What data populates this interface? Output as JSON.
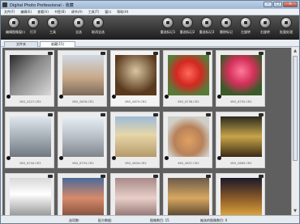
{
  "app": {
    "title": "Digital Photo Professional - 收藏"
  },
  "window_buttons": [
    "–",
    "□",
    "×"
  ],
  "menu": [
    "文件(F)",
    "编辑(E)",
    "查看(V)",
    "书签(B)",
    "调节(A)",
    "工具(T)",
    "窗口",
    "帮助(H)"
  ],
  "toolbar": [
    {
      "label": "编辑图像窗口",
      "icon": "edit-window-icon"
    },
    {
      "label": "打开",
      "icon": "open-icon"
    },
    {
      "label": "工具",
      "icon": "tools-icon"
    },
    {
      "label": "全选",
      "icon": "select-all-icon"
    },
    {
      "label": "取消全选",
      "icon": "deselect-icon"
    },
    {
      "label": "重选标记1",
      "icon": "check-mark1-icon"
    },
    {
      "label": "重选标记2",
      "icon": "check-mark2-icon"
    },
    {
      "label": "重选标记3",
      "icon": "check-mark3-icon"
    },
    {
      "label": "删除标记",
      "icon": "clear-mark-icon"
    },
    {
      "label": "左旋转",
      "icon": "rotate-left-icon"
    },
    {
      "label": "右旋转",
      "icon": "rotate-right-icon"
    },
    {
      "label": "批量处理",
      "icon": "batch-process-icon"
    }
  ],
  "tabs": {
    "folder": "文件夹",
    "collection": "收藏(15)"
  },
  "thumbnails": [
    {
      "name": "IMG_0227.CR2",
      "selected": false
    },
    {
      "name": "IMG_0876.CR2",
      "selected": false
    },
    {
      "name": "IMG_0675.CR2",
      "selected": true
    },
    {
      "name": "IMG_6736.CR2",
      "selected": false
    },
    {
      "name": "IMG_6755.CR2",
      "selected": false
    },
    {
      "name": "IMG_6744.CR2",
      "selected": false
    },
    {
      "name": "IMG_6793.CR2",
      "selected": false
    },
    {
      "name": "IMG_0834.CR2",
      "selected": false
    },
    {
      "name": "IMG_0837.CR2",
      "selected": false
    },
    {
      "name": "IMG_0669.CR2",
      "selected": false
    },
    {
      "name": "IMG_0751.CR2",
      "selected": false
    },
    {
      "name": "IMG_6306.CR2",
      "selected": false
    },
    {
      "name": "IMG_0102.CR2",
      "selected": false
    },
    {
      "name": "IMG_0115.CR2",
      "selected": false
    },
    {
      "name": "IMG_0121.CR2",
      "selected": false
    }
  ],
  "status": {
    "selected": "选项数:",
    "assigned": "配方数据:",
    "count": "图像数目: 15",
    "selected_count": "被选的图像数目: 0"
  },
  "colors": {
    "toolbar_dark": "#1d1d1d",
    "content_bg": "#5f5f5f",
    "cell_bg": "#ececec"
  }
}
